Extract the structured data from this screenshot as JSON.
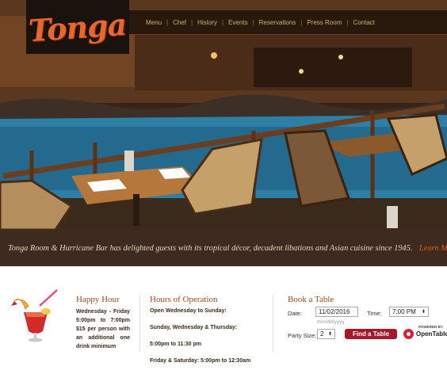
{
  "brand": {
    "logo_text": "Tonga"
  },
  "nav": {
    "items": [
      "Menu",
      "Chef",
      "History",
      "Events",
      "Reservations",
      "Press Room",
      "Contact"
    ]
  },
  "caption": {
    "text": "Tonga Room & Hurricane Bar has delighted guests with its tropical décor, decadent libations and Asian cuisine since 1945.",
    "learn_more": "Learn More>"
  },
  "happy_hour": {
    "title": "Happy Hour",
    "body": "Wednesday - Friday 5:00pm to 7:00pm $15 per person with an additional one drink minimum"
  },
  "hours": {
    "title": "Hours of Operation",
    "lines": [
      "Open Wednesday to Sunday:",
      "Sunday, Wednesday & Thursday:",
      "5:00pm to 11:30 pm",
      "Friday & Saturday: 5:00pm to 12:30am"
    ]
  },
  "booking": {
    "title": "Book a Table",
    "date_label": "Date:",
    "date_value": "11/02/2016",
    "date_hint": "mm/dd/yyyy",
    "time_label": "Time:",
    "time_value": "7:00 PM",
    "party_label": "Party Size:",
    "party_value": "2",
    "find_button": "Find a Table",
    "powered_by": "POWERED BY",
    "opentable": "OpenTable"
  },
  "colors": {
    "accent": "#a3461f",
    "button": "#a5182b",
    "nav_text": "#c9b46a",
    "caption_bar": "#3c2b1e"
  }
}
